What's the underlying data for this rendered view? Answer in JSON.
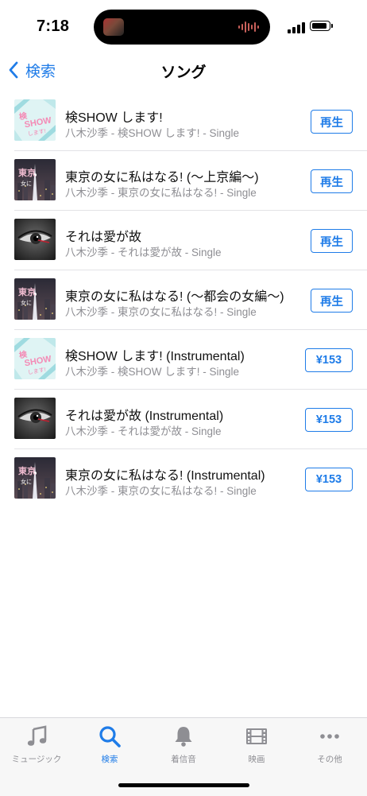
{
  "status_bar": {
    "time": "7:18",
    "icons": [
      "now-playing-thumbnail-icon",
      "audio-waveform-icon",
      "cellular-signal-icon",
      "battery-icon"
    ]
  },
  "nav": {
    "back_label": "検索",
    "title": "ソング"
  },
  "songs": [
    {
      "title": "検SHOW します!",
      "subtitle": "八木沙季 - 検SHOW します! - Single",
      "action": "再生",
      "action_type": "play",
      "art": "show"
    },
    {
      "title": "東京の女に私はなる! (〜上京編〜)",
      "subtitle": "八木沙季 - 東京の女に私はなる! - Single",
      "action": "再生",
      "action_type": "play",
      "art": "tokyo"
    },
    {
      "title": "それは愛が故",
      "subtitle": "八木沙季 - それは愛が故 - Single",
      "action": "再生",
      "action_type": "play",
      "art": "eye"
    },
    {
      "title": "東京の女に私はなる! (〜都会の女編〜)",
      "subtitle": "八木沙季 - 東京の女に私はなる! - Single",
      "action": "再生",
      "action_type": "play",
      "art": "tokyo"
    },
    {
      "title": "検SHOW します! (Instrumental)",
      "subtitle": "八木沙季 - 検SHOW します! - Single",
      "action": "¥153",
      "action_type": "price",
      "art": "show"
    },
    {
      "title": "それは愛が故 (Instrumental)",
      "subtitle": "八木沙季 - それは愛が故 - Single",
      "action": "¥153",
      "action_type": "price",
      "art": "eye"
    },
    {
      "title": "東京の女に私はなる! (Instrumental)",
      "subtitle": "八木沙季 - 東京の女に私はなる! - Single",
      "action": "¥153",
      "action_type": "price",
      "art": "tokyo"
    }
  ],
  "tab_bar": {
    "items": [
      {
        "label": "ミュージック",
        "icon": "music-note-icon",
        "active": false
      },
      {
        "label": "検索",
        "icon": "search-icon",
        "active": true
      },
      {
        "label": "着信音",
        "icon": "bell-icon",
        "active": false
      },
      {
        "label": "映画",
        "icon": "film-icon",
        "active": false
      },
      {
        "label": "その他",
        "icon": "more-icon",
        "active": false
      }
    ]
  },
  "colors": {
    "accent": "#1f7ce8",
    "secondary_text": "#8e8e93",
    "tab_inactive": "#8e8e93"
  }
}
